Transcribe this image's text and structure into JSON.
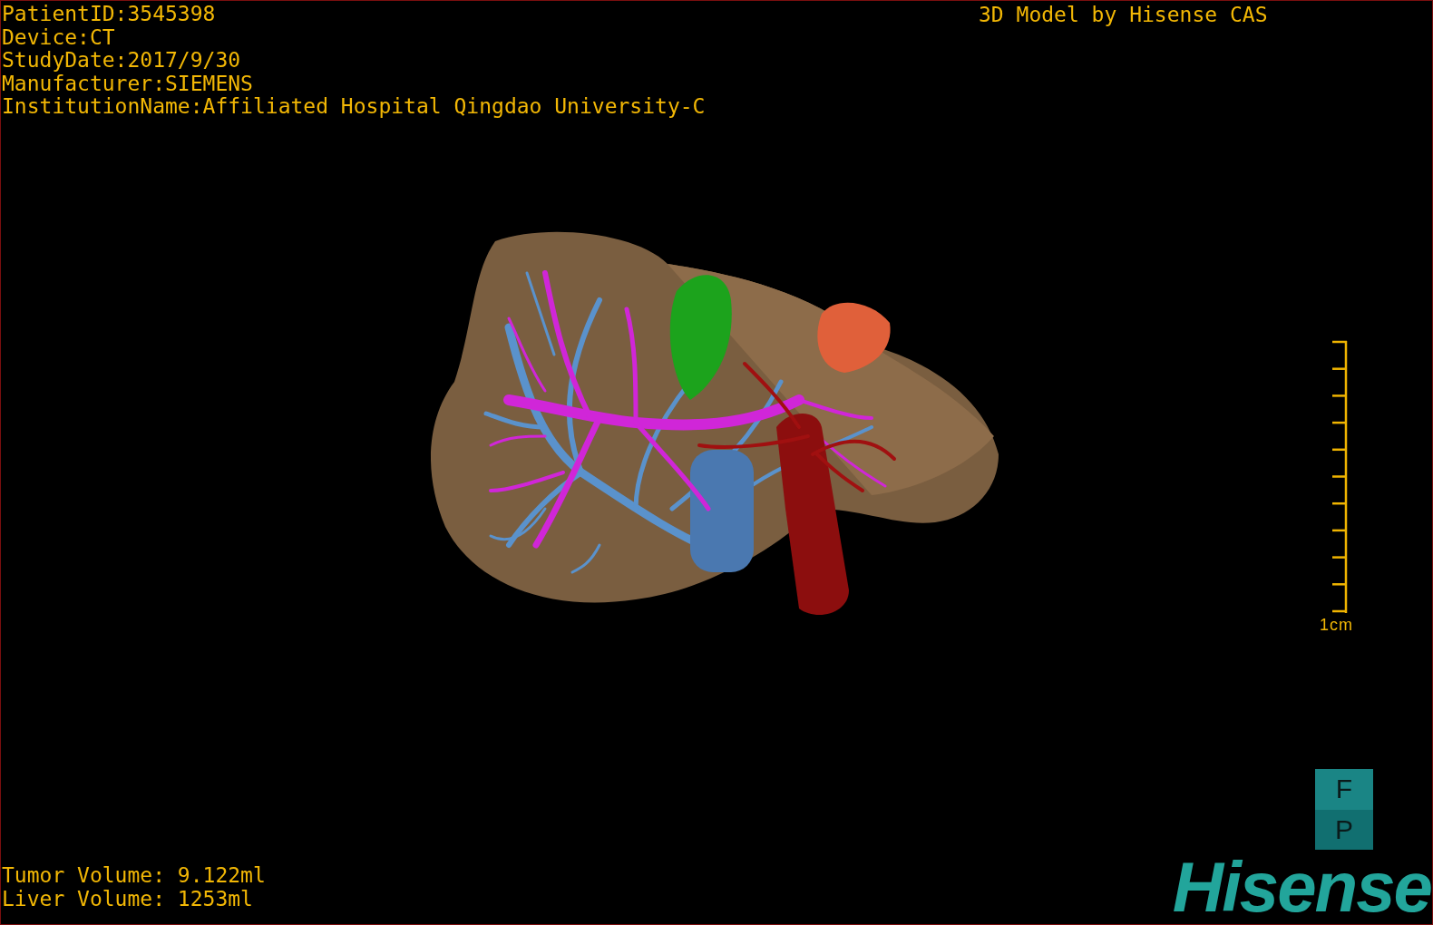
{
  "patient_info": [
    "PatientID:3545398",
    "Device:CT",
    "StudyDate:2017/9/30",
    "Manufacturer:SIEMENS",
    "InstitutionName:Affiliated Hospital Qingdao University-C"
  ],
  "title": "3D Model by Hisense CAS",
  "scale": {
    "label": "1cm"
  },
  "orientation": {
    "faces": [
      "F",
      "P"
    ]
  },
  "logo": "Hisense",
  "volumes": [
    "Tumor Volume: 9.122ml",
    "Liver Volume: 1253ml"
  ]
}
